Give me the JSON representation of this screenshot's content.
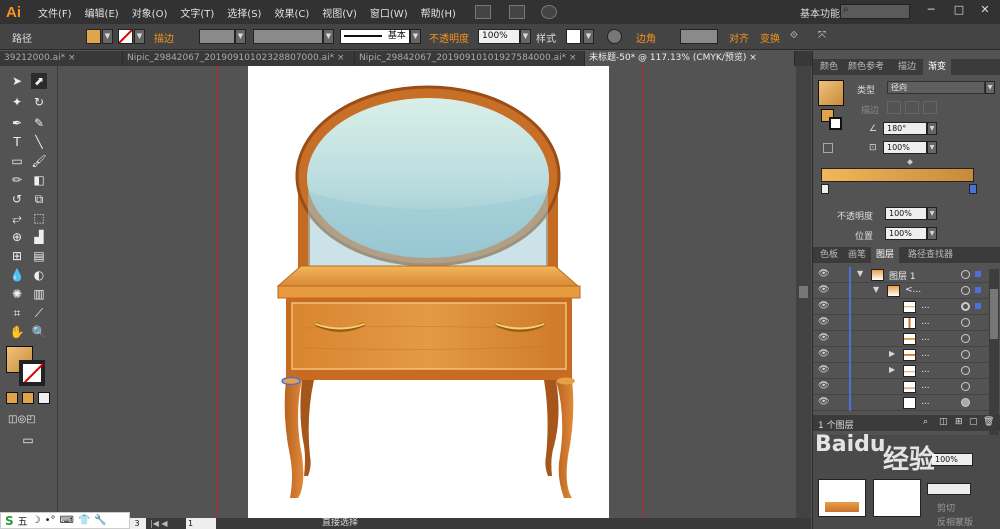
{
  "app": {
    "logo": "Ai",
    "workspace": "基本功能",
    "min_glyph": "─",
    "max_glyph": "□",
    "close_glyph": "✕"
  },
  "menu": [
    "文件(F)",
    "编辑(E)",
    "对象(O)",
    "文字(T)",
    "选择(S)",
    "效果(C)",
    "视图(V)",
    "窗口(W)",
    "帮助(H)"
  ],
  "control": {
    "path_label": "路径",
    "stroke_label": "描边",
    "stroke_style": "基本",
    "opacity_label": "不透明度",
    "opacity_value": "100%",
    "style_label": "样式",
    "corner_label": "边角",
    "align_label": "对齐",
    "transform_label": "变换"
  },
  "tabs": [
    "39212000.ai* ×",
    "Nipic_29842067_20190910102328807000.ai* ×",
    "Nipic_29842067_20190910101927584000.ai* ×",
    "未标题-50* @ 117.13% (CMYK/预览) ×"
  ],
  "status": {
    "zoom": "3",
    "page_arrows": "|◀ ◀",
    "page": "1",
    "tool": "直接选择"
  },
  "gradient_panel": {
    "tabs": [
      "颜色",
      "颜色参考",
      "描边",
      "渐变"
    ],
    "type_label": "类型",
    "type_value": "径向",
    "stroke_label": "描边",
    "angle": "180°",
    "aspect": "100%",
    "opacity_label": "不透明度",
    "opacity_value": "100%",
    "location_label": "位置",
    "location_value": "100%"
  },
  "layers_panel": {
    "tabs": [
      "色板",
      "画笔",
      "图层",
      "路径查找器"
    ],
    "layer_name": "图层 1",
    "sublayer_name": "<...",
    "item_name": "...",
    "footer": "1 个图层"
  },
  "ime": {
    "items": [
      "五",
      "☽",
      "•°",
      "⌨",
      "👕",
      "🔧"
    ]
  },
  "watermark": "经验",
  "bottom_panel": {
    "clip_label": "剪切",
    "invert_label": "反相蒙版"
  },
  "colors": {
    "accent": "#f7941d",
    "wood_light": "#f2b65a",
    "wood_dark": "#c88a3a",
    "mirror": "#cfe6ea"
  }
}
